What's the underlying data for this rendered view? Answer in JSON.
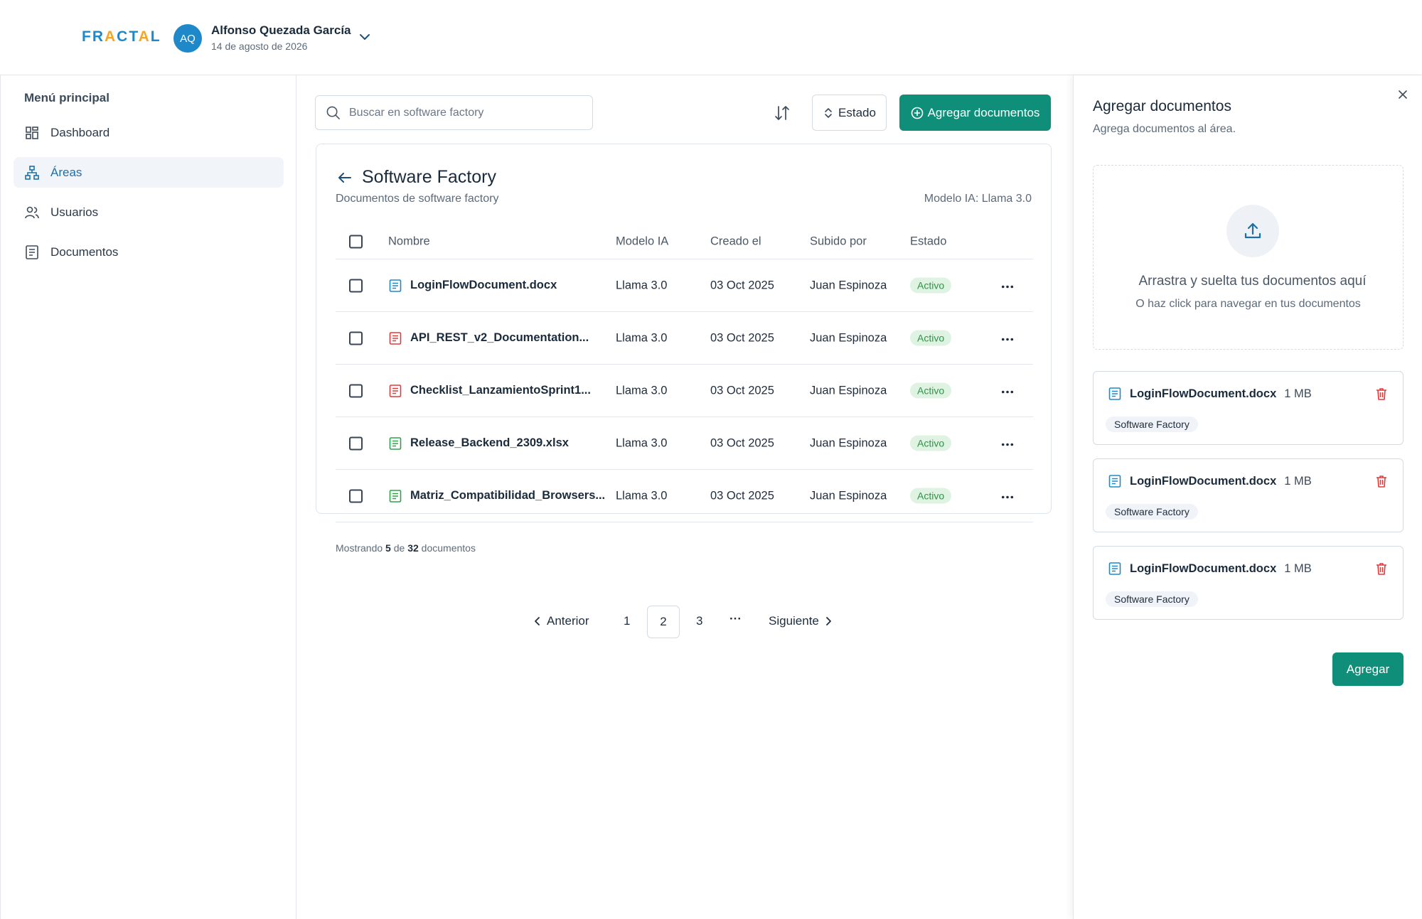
{
  "header": {
    "logo": [
      "FR",
      "A",
      "CT",
      "A",
      "L"
    ],
    "avatar_initials": "AQ",
    "user_name": "Alfonso Quezada García",
    "date": "14 de agosto de 2026"
  },
  "sidebar": {
    "title": "Menú principal",
    "items": [
      {
        "label": "Dashboard",
        "icon": "dashboard-icon",
        "active": false
      },
      {
        "label": "Áreas",
        "icon": "hierarchy-icon",
        "active": true
      },
      {
        "label": "Usuarios",
        "icon": "users-icon",
        "active": false
      },
      {
        "label": "Documentos",
        "icon": "document-icon",
        "active": false
      }
    ]
  },
  "toolbar": {
    "search_placeholder": "Buscar en software factory",
    "estado_label": "Estado",
    "add_label": "Agregar documentos"
  },
  "card": {
    "title": "Software Factory",
    "subtitle": "Documentos de software factory",
    "model": "Modelo IA: Llama 3.0",
    "columns": [
      "Nombre",
      "Modelo IA",
      "Creado el",
      "Subido por",
      "Estado"
    ],
    "rows": [
      {
        "name": "LoginFlowDocument.docx",
        "type": "doc",
        "color": "#1e88c9",
        "model": "Llama 3.0",
        "date": "03 Oct 2025",
        "user": "Juan Espinoza",
        "state": "Activo"
      },
      {
        "name": "API_REST_v2_Documentation...",
        "type": "pdf",
        "color": "#e03b3b",
        "model": "Llama 3.0",
        "date": "03 Oct 2025",
        "user": "Juan Espinoza",
        "state": "Activo"
      },
      {
        "name": "Checklist_LanzamientoSprint1...",
        "type": "pdf",
        "color": "#e03b3b",
        "model": "Llama 3.0",
        "date": "03 Oct 2025",
        "user": "Juan Espinoza",
        "state": "Activo"
      },
      {
        "name": "Release_Backend_2309.xlsx",
        "type": "xls",
        "color": "#2ea24b",
        "model": "Llama 3.0",
        "date": "03 Oct 2025",
        "user": "Juan Espinoza",
        "state": "Activo"
      },
      {
        "name": "Matriz_Compatibilidad_Browsers...",
        "type": "xls",
        "color": "#2ea24b",
        "model": "Llama 3.0",
        "date": "03 Oct 2025",
        "user": "Juan Espinoza",
        "state": "Activo"
      }
    ],
    "footer_prefix": "Mostrando",
    "footer_shown": "5",
    "footer_mid": "de",
    "footer_total": "32",
    "footer_suffix": "documentos"
  },
  "pagination": {
    "prev": "Anterior",
    "pages": [
      "1",
      "2",
      "3"
    ],
    "current": "2",
    "ellipsis": "···",
    "next": "Siguiente"
  },
  "panel": {
    "title": "Agregar documentos",
    "subtitle": "Agrega documentos al área.",
    "drop_title": "Arrastra y suelta tus documentos aquí",
    "drop_sub": "O haz click para navegar en tus documentos",
    "files": [
      {
        "name": "LoginFlowDocument.docx",
        "size": "1 MB",
        "tag": "Software Factory"
      },
      {
        "name": "LoginFlowDocument.docx",
        "size": "1 MB",
        "tag": "Software Factory"
      },
      {
        "name": "LoginFlowDocument.docx",
        "size": "1 MB",
        "tag": "Software Factory"
      }
    ],
    "add_label": "Agregar"
  },
  "colors": {
    "accent": "#0f8f7a",
    "brand_blue": "#1e88c9",
    "brand_orange": "#f5a623",
    "danger": "#e03b3b"
  }
}
